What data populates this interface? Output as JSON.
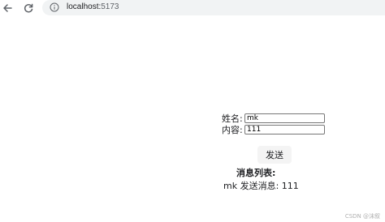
{
  "browser": {
    "url_host": "localhost:",
    "url_port": "5173",
    "icons": {
      "back": "back-arrow-icon",
      "reload": "reload-icon",
      "info": "info-icon"
    }
  },
  "form": {
    "name_label": "姓名:",
    "name_value": "mk",
    "content_label": "内容:",
    "content_value": "111",
    "send_label": "发送"
  },
  "messages": {
    "title": "消息列表:",
    "items": [
      {
        "text": "mk 发送消息: 111"
      }
    ]
  },
  "watermark": "CSDN @沫叙"
}
